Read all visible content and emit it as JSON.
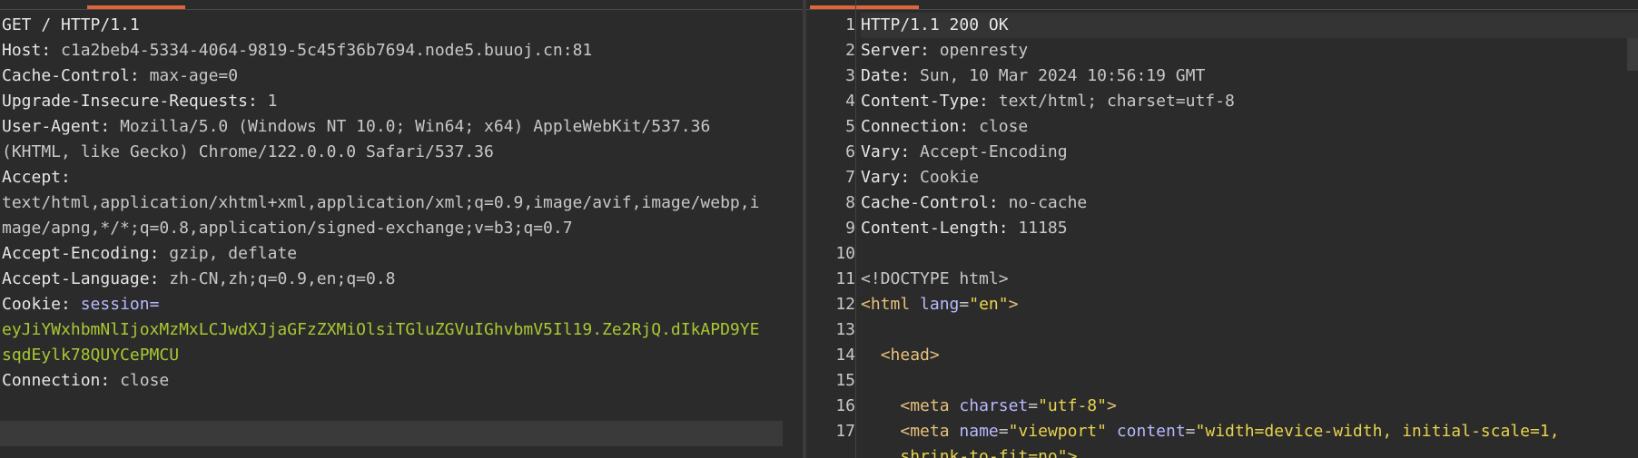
{
  "request": {
    "lines": [
      {
        "k": "",
        "v": "GET / HTTP/1.1"
      },
      {
        "k": "Host",
        "v": "c1a2beb4-5334-4064-9819-5c45f36b7694.node5.buuoj.cn:81"
      },
      {
        "k": "Cache-Control",
        "v": "max-age=0"
      },
      {
        "k": "Upgrade-Insecure-Requests",
        "v": "1"
      },
      {
        "k": "User-Agent",
        "v": "Mozilla/5.0 (Windows NT 10.0; Win64; x64) AppleWebKit/537.36"
      },
      {
        "k": "",
        "v": "(KHTML, like Gecko) Chrome/122.0.0.0 Safari/537.36"
      },
      {
        "k": "Accept",
        "v": ""
      },
      {
        "k": "",
        "v": "text/html,application/xhtml+xml,application/xml;q=0.9,image/avif,image/webp,i"
      },
      {
        "k": "",
        "v": "mage/apng,*/*;q=0.8,application/signed-exchange;v=b3;q=0.7"
      },
      {
        "k": "Accept-Encoding",
        "v": "gzip, deflate"
      },
      {
        "k": "Accept-Language",
        "v": "zh-CN,zh;q=0.9,en;q=0.8"
      }
    ],
    "cookie": {
      "label": "Cookie",
      "key": "session=",
      "value1": "eyJiYWxhbmNlIjoxMzMxLCJwdXJjaGFzZXMiOlsiTGluZGVuIGhvbmV5Il19.Ze2RjQ.dIkAPD9YE",
      "value2": "sqdEylk78QUYCePMCU"
    },
    "connection": {
      "k": "Connection",
      "v": "close"
    }
  },
  "response": {
    "line_numbers": [
      "1",
      "2",
      "3",
      "4",
      "5",
      "6",
      "7",
      "8",
      "9",
      "10",
      "11",
      "12",
      "13",
      "14",
      "15",
      "16",
      "17"
    ],
    "status": "HTTP/1.1 200 OK",
    "headers": [
      {
        "k": "Server",
        "v": "openresty"
      },
      {
        "k": "Date",
        "v": "Sun, 10 Mar 2024 10:56:19 GMT"
      },
      {
        "k": "Content-Type",
        "v": "text/html; charset=utf-8"
      },
      {
        "k": "Connection",
        "v": "close"
      },
      {
        "k": "Vary",
        "v": "Accept-Encoding"
      },
      {
        "k": "Vary",
        "v": "Cookie"
      },
      {
        "k": "Cache-Control",
        "v": "no-cache"
      },
      {
        "k": "Content-Length",
        "v": "11185"
      }
    ],
    "doctype": "<!DOCTYPE html>",
    "html_open_tag": "<html",
    "html_lang_attr": "lang",
    "html_lang_val": "\"en\"",
    "html_close": ">",
    "head_tag": "<head>",
    "meta1_tag": "<meta",
    "meta1_attr": "charset",
    "meta1_val": "\"utf-8\"",
    "meta1_close": ">",
    "meta2_tag": "<meta",
    "meta2_attr1": "name",
    "meta2_val1": "\"viewport\"",
    "meta2_attr2": "content",
    "meta2_val2": "\"width=device-width, initial-scale=1,",
    "meta2_cont": "shrink-to-fit=no\">"
  },
  "colors": {
    "accent": "#e0663a",
    "background": "#2b2b2b"
  }
}
